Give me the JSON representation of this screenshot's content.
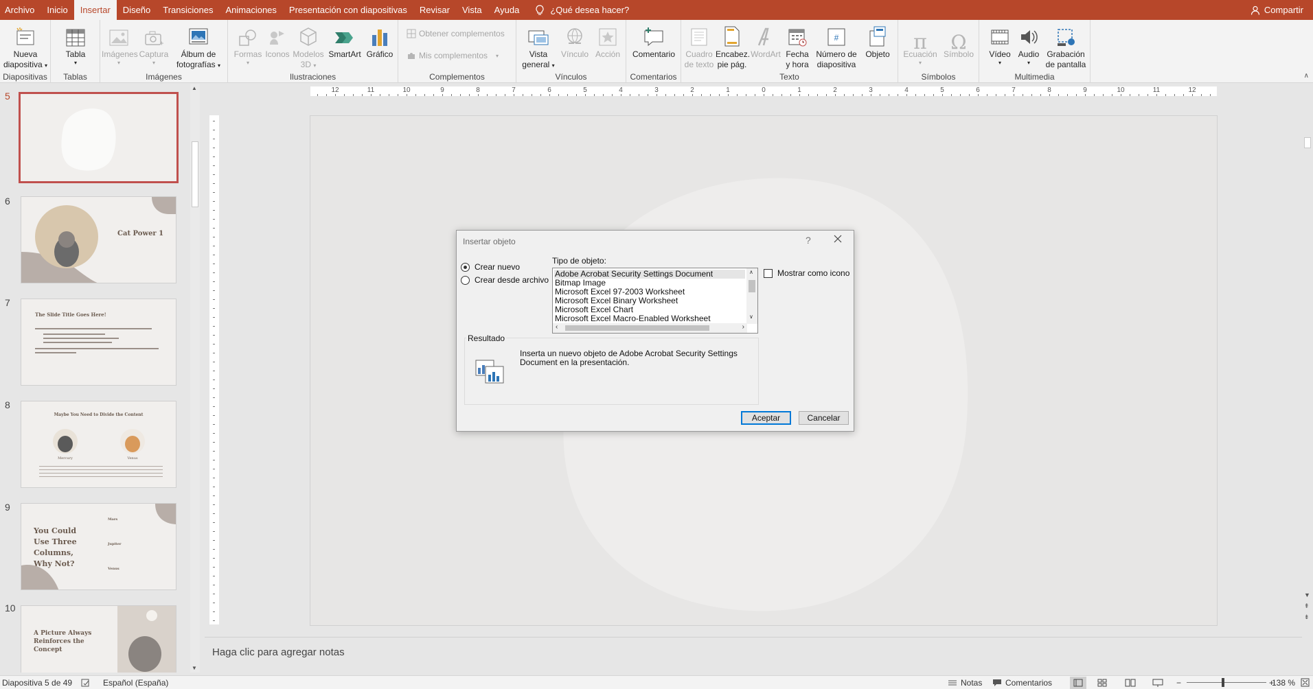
{
  "tabs": [
    "Archivo",
    "Inicio",
    "Insertar",
    "Diseño",
    "Transiciones",
    "Animaciones",
    "Presentación con diapositivas",
    "Revisar",
    "Vista",
    "Ayuda"
  ],
  "active_tab_index": 2,
  "tell_me": "¿Qué desea hacer?",
  "share": "Compartir",
  "ribbon": {
    "groups": {
      "diapositivas": "Diapositivas",
      "tablas": "Tablas",
      "imagenes": "Imágenes",
      "ilustraciones": "Ilustraciones",
      "complementos": "Complementos",
      "vinculos": "Vínculos",
      "comentarios": "Comentarios",
      "texto": "Texto",
      "simbolos": "Símbolos",
      "multimedia": "Multimedia"
    },
    "buttons": {
      "nueva_1": "Nueva",
      "nueva_2": "diapositiva",
      "tabla": "Tabla",
      "imagenes": "Imágenes",
      "captura": "Captura",
      "album_1": "Álbum de",
      "album_2": "fotografías",
      "formas": "Formas",
      "iconos": "Iconos",
      "modelos_1": "Modelos",
      "modelos_2": "3D",
      "smartart": "SmartArt",
      "grafico": "Gráfico",
      "obtener": "Obtener complementos",
      "mis": "Mis complementos",
      "vista_1": "Vista",
      "vista_2": "general",
      "vinculo": "Vínculo",
      "accion": "Acción",
      "comentario": "Comentario",
      "cuadro_1": "Cuadro",
      "cuadro_2": "de texto",
      "encab_1": "Encabez.",
      "encab_2": "pie pág.",
      "wordart": "WordArt",
      "fecha_1": "Fecha",
      "fecha_2": "y hora",
      "numero_1": "Número de",
      "numero_2": "diapositiva",
      "objeto": "Objeto",
      "ecuacion": "Ecuación",
      "simbolo": "Símbolo",
      "video": "Vídeo",
      "audio": "Audio",
      "grabacion_1": "Grabación",
      "grabacion_2": "de pantalla"
    }
  },
  "slides": [
    {
      "num": "5"
    },
    {
      "num": "6",
      "title": "Cat Power 1"
    },
    {
      "num": "7",
      "title": "The Slide Title Goes Here!"
    },
    {
      "num": "8",
      "title": "Maybe You Need to Divide the Content",
      "left": "Mercury",
      "right": "Venus"
    },
    {
      "num": "9",
      "title": "You Could Use Three Columns, Why Not?",
      "c1": "Mars",
      "c2": "Jupiter",
      "c3": "Venus"
    },
    {
      "num": "10",
      "title": "A Picture Always Reinforces the Concept"
    }
  ],
  "ruler_labels": [
    "12",
    "11",
    "10",
    "9",
    "8",
    "7",
    "6",
    "5",
    "4",
    "3",
    "2",
    "1",
    "0",
    "1",
    "2",
    "3",
    "4",
    "5",
    "6",
    "7",
    "8",
    "9",
    "10",
    "11",
    "12"
  ],
  "notes_placeholder": "Haga clic para agregar notas",
  "status": {
    "slide_info": "Diapositiva 5 de 49",
    "language": "Español (España)",
    "notes": "Notas",
    "comments": "Comentarios",
    "zoom": "138 %"
  },
  "dialog": {
    "title": "Insertar objeto",
    "help": "?",
    "crear_nuevo": "Crear nuevo",
    "crear_desde": "Crear desde archivo",
    "tipo_label": "Tipo de objeto:",
    "object_types": [
      "Adobe Acrobat Security Settings Document",
      "Bitmap Image",
      "Microsoft Excel 97-2003 Worksheet",
      "Microsoft Excel Binary Worksheet",
      "Microsoft Excel Chart",
      "Microsoft Excel Macro-Enabled Worksheet"
    ],
    "mostrar_icono": "Mostrar como icono",
    "resultado_label": "Resultado",
    "resultado_text": "Inserta un nuevo objeto de Adobe Acrobat Security Settings Document en la presentación.",
    "aceptar": "Aceptar",
    "cancelar": "Cancelar"
  }
}
